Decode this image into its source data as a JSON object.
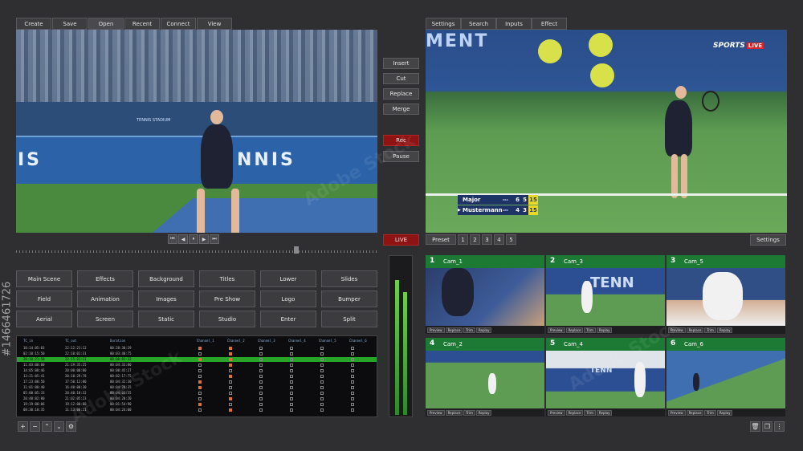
{
  "left_menu": [
    "Create",
    "Save",
    "Open",
    "Recent",
    "Connect",
    "View"
  ],
  "right_menu": [
    "Settings",
    "Search",
    "Inputs",
    "Effect"
  ],
  "side_buttons": [
    "Insert",
    "Cut",
    "Replace",
    "Merge"
  ],
  "rec_label": "Rec",
  "pause_label": "Pause",
  "live_label": "LIVE",
  "left_monitor": {
    "stadium_text": "TENNIS STADIUM",
    "banner_text": "NNIS"
  },
  "right_monitor": {
    "banner_text": "MENT",
    "channel_logo": "SPORTS",
    "channel_live": "LIVE",
    "score": [
      {
        "name": "Major",
        "country": "USA",
        "set1": "6",
        "set2": "5",
        "game": "15",
        "serving": false
      },
      {
        "name": "Mustermann",
        "country": "GER",
        "set1": "4",
        "set2": "3",
        "game": "15",
        "serving": true
      }
    ]
  },
  "transport_icons": [
    "skip-back",
    "step-back",
    "pause",
    "step-forward",
    "skip-forward"
  ],
  "preset_label": "Preset",
  "preset_numbers": [
    "1",
    "2",
    "3",
    "4",
    "5"
  ],
  "settings_label": "Settings",
  "scene_buttons": [
    [
      "Main Scene",
      "Effects",
      "Background",
      "Titles",
      "Lower",
      "Slides"
    ],
    [
      "Field",
      "Animation",
      "Images",
      "Pre Show",
      "Logo",
      "Bumper"
    ],
    [
      "Aerial",
      "Screen",
      "Static",
      "Studio",
      "Enter",
      "Split"
    ]
  ],
  "log_headers": [
    "TC_in",
    "TC_out",
    "Duration",
    "Channel_1",
    "Channel_2",
    "Channel_3",
    "Channel_4",
    "Channel_5",
    "Channel_6"
  ],
  "log_rows": [
    [
      "10:14:05:03",
      "22:12:21:12",
      "00:20:30:29"
    ],
    [
      "02:10:15:50",
      "22:10:01:31",
      "00:03:40:75"
    ],
    [
      "20:10:21:50",
      "22:15:01:11",
      "00:00:01:32"
    ],
    [
      "11:03:00:00",
      "21:19:35:25",
      "00:04:33:80"
    ],
    [
      "14:05:08:46",
      "20:00:00:00",
      "00:00:45:27"
    ],
    [
      "13:21:05:41",
      "20:18:29:78",
      "00:02:17:75"
    ],
    [
      "17:23:00:50",
      "17:50:12:80",
      "00:04:32:30"
    ],
    [
      "11:01:00:40",
      "16:40:00:30",
      "00:04:29:35"
    ],
    [
      "05:00:05:33",
      "20:40:10:32",
      "00:04:03:35"
    ],
    [
      "20:40:02:80",
      "21:02:05:23",
      "00:04:20:20"
    ],
    [
      "19:19:00:06",
      "19:12:00:00",
      "00:01:54:90"
    ],
    [
      "08:30:10:35",
      "11:13:00:21",
      "00:04:24:00"
    ]
  ],
  "cameras": [
    {
      "num": "1",
      "name": "Cam_1"
    },
    {
      "num": "2",
      "name": "Cam_3"
    },
    {
      "num": "3",
      "name": "Cam_5"
    },
    {
      "num": "4",
      "name": "Cam_2"
    },
    {
      "num": "5",
      "name": "Cam_4"
    },
    {
      "num": "6",
      "name": "Cam_6"
    }
  ],
  "cam_controls": [
    "Preview",
    "Replace",
    "Trim",
    "Replay"
  ],
  "cam_tile_text": "TENN",
  "bottom_left_icons": [
    "add-icon",
    "remove-icon",
    "chevron-up-icon",
    "chevron-down-icon",
    "gear-icon"
  ],
  "bottom_right_icons": [
    "trash-icon",
    "duplicate-icon",
    "more-vertical-icon"
  ],
  "watermark": "Adobe Stock",
  "side_id": "#1466461726",
  "colors": {
    "accent_green": "#1d7a34",
    "rec_red": "#8e1414",
    "log_highlight": "#28a428"
  }
}
